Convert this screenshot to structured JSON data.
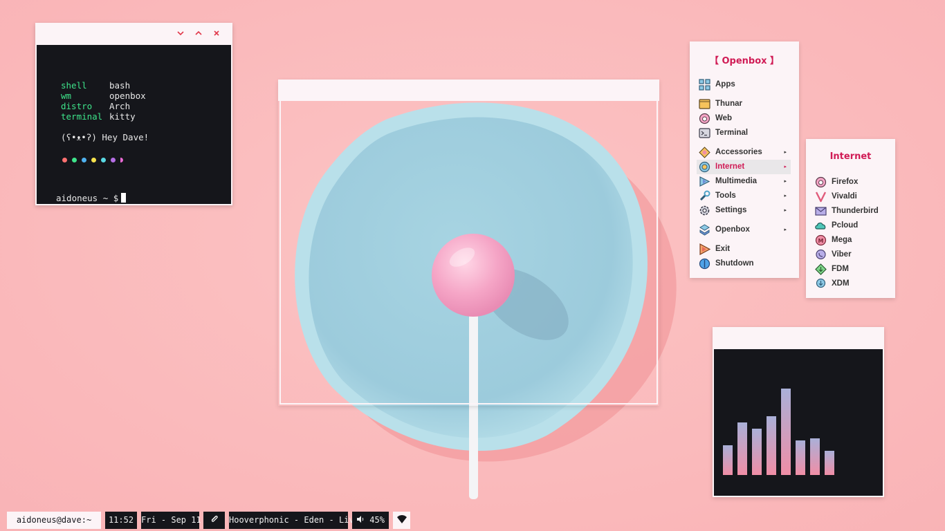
{
  "desktop": {
    "theme_accent": "#d01b55",
    "wallpaper": "pink-lollipop-on-blue-plate"
  },
  "terminal": {
    "titlebar_icons": [
      "chevron-down-icon",
      "chevron-up-icon",
      "close-icon"
    ],
    "fetch": [
      {
        "key": "shell",
        "value": "bash"
      },
      {
        "key": "wm",
        "value": "openbox"
      },
      {
        "key": "distro",
        "value": "Arch"
      },
      {
        "key": "terminal",
        "value": "kitty"
      }
    ],
    "greeting": "(ʕ•ᴥ•ʔ) Hey Dave!",
    "color_dots": [
      "#ff7070",
      "#3ee58b",
      "#4fb1f0",
      "#f6e24d",
      "#59d9e4",
      "#b56ee5",
      "#e86ad4"
    ],
    "prompt": "aidoneus ~ $"
  },
  "openbox_menu": {
    "title": "【 Openbox 】",
    "items": [
      {
        "label": "Apps",
        "icon": "apps-grid-icon",
        "arrow": ""
      },
      {
        "label": "Thunar",
        "icon": "folder-icon",
        "arrow": ""
      },
      {
        "label": "Web",
        "icon": "firefox-icon",
        "arrow": ""
      },
      {
        "label": "Terminal",
        "icon": "terminal-icon",
        "arrow": ""
      },
      {
        "label": "Accessories",
        "icon": "accessories-icon",
        "arrow": "▸"
      },
      {
        "label": "Internet",
        "icon": "internet-icon",
        "arrow": "▸"
      },
      {
        "label": "Multimedia",
        "icon": "multimedia-icon",
        "arrow": "▸"
      },
      {
        "label": "Tools",
        "icon": "wrench-icon",
        "arrow": "▸"
      },
      {
        "label": "Settings",
        "icon": "gear-icon",
        "arrow": "▸"
      },
      {
        "label": "Openbox",
        "icon": "openbox-icon",
        "arrow": "▸"
      },
      {
        "label": "Exit",
        "icon": "exit-icon",
        "arrow": ""
      },
      {
        "label": "Shutdown",
        "icon": "power-icon",
        "arrow": ""
      }
    ]
  },
  "internet_menu": {
    "title": "Internet",
    "items": [
      {
        "label": "Firefox",
        "icon": "firefox-icon"
      },
      {
        "label": "Vivaldi",
        "icon": "vivaldi-icon"
      },
      {
        "label": "Thunderbird",
        "icon": "mail-icon"
      },
      {
        "label": "Pcloud",
        "icon": "cloud-icon"
      },
      {
        "label": "Mega",
        "icon": "mega-icon"
      },
      {
        "label": "Viber",
        "icon": "viber-icon"
      },
      {
        "label": "FDM",
        "icon": "download-manager-icon"
      },
      {
        "label": "XDM",
        "icon": "xdm-download-icon"
      }
    ]
  },
  "visualizer": {
    "levels": [
      0.28,
      0.5,
      0.44,
      0.56,
      0.82,
      0.33,
      0.35,
      0.23
    ]
  },
  "statusbar": {
    "workspace": "aidoneus@dave:~",
    "time": "11:52",
    "date": "Fri - Sep 11",
    "clip_icon": "paperclip-icon",
    "now_playing": "Hooverphonic - Eden - Live",
    "volume_icon": "speaker-icon",
    "volume": "45%",
    "wifi_icon": "wifi-icon"
  }
}
